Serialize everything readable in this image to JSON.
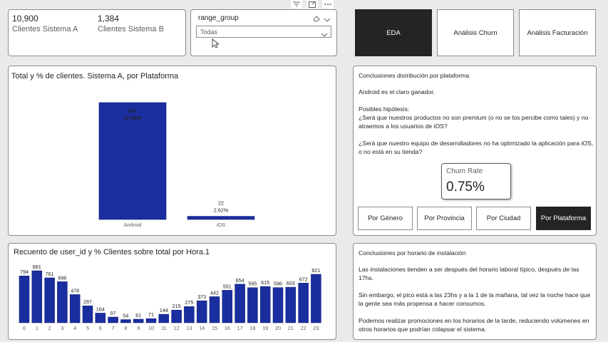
{
  "kpis": [
    {
      "value": "10,900",
      "label": "Clientes Sistema A"
    },
    {
      "value": "1,384",
      "label": "Clientes Sistema B"
    }
  ],
  "slicer": {
    "title": "range_group",
    "selected": "Todas"
  },
  "nav": [
    "EDA",
    "Análisis Churn",
    "Análisis Facturación"
  ],
  "platform_chart": {
    "title": "Total y % de clientes. Sistema A, por Plataforma",
    "chart_data": {
      "type": "bar",
      "categories": [
        "Android",
        "iOS"
      ],
      "values": [
        817,
        22
      ],
      "percents": [
        "97.38%",
        "2.62%"
      ]
    }
  },
  "conclusions_platform": {
    "title": "Conclusiones distribución por plataforma",
    "p1": "Android es el claro ganador.",
    "p2_head": "Posibles hipótesis:",
    "p2_body": "¿Será que nuestros productos no son premium (o no se los percibe como tales) y no atraemos a los usuarios de iOS?",
    "p3": "¿Será que nuestro equipo de desarrolladores no ha optimizado la aplicación para iOS, o no está en su tienda?"
  },
  "churn_card": {
    "label": "Churn Rate",
    "value": "0.75%"
  },
  "sub_buttons": [
    "Por Género",
    "Por Provincia",
    "Por Ciudad",
    "Por Plataforma"
  ],
  "hour_chart": {
    "title": "Recuento de user_id y % Clientes sobre total por Hora.1",
    "chart_data": {
      "type": "bar",
      "categories": [
        "0",
        "1",
        "2",
        "3",
        "4",
        "5",
        "6",
        "7",
        "8",
        "9",
        "10",
        "11",
        "12",
        "13",
        "14",
        "15",
        "16",
        "17",
        "18",
        "19",
        "20",
        "21",
        "22",
        "23"
      ],
      "values": [
        794,
        881,
        761,
        696,
        478,
        287,
        164,
        97,
        54,
        61,
        71,
        144,
        215,
        275,
        373,
        442,
        551,
        654,
        595,
        615,
        596,
        603,
        672,
        821
      ]
    }
  },
  "conclusions_hour": {
    "title": "Conclusiones por horario de instalación",
    "p1": "Las instalaciones tienden a ser después del horario laboral típico, después de las 17hs.",
    "p2": "Sin embargo, el pico está a las 23hs y a la 1 de la mañana, tal vez la noche hace que la gente sea más propensa a hacer consumos.",
    "p3": "Podemos realizar promociones en los horarios de la tarde, reduciendo volúmenes en otros horarios que podrían colapsar el sistema."
  },
  "colors": {
    "bar": "#1a2ea0",
    "dark": "#252423"
  }
}
